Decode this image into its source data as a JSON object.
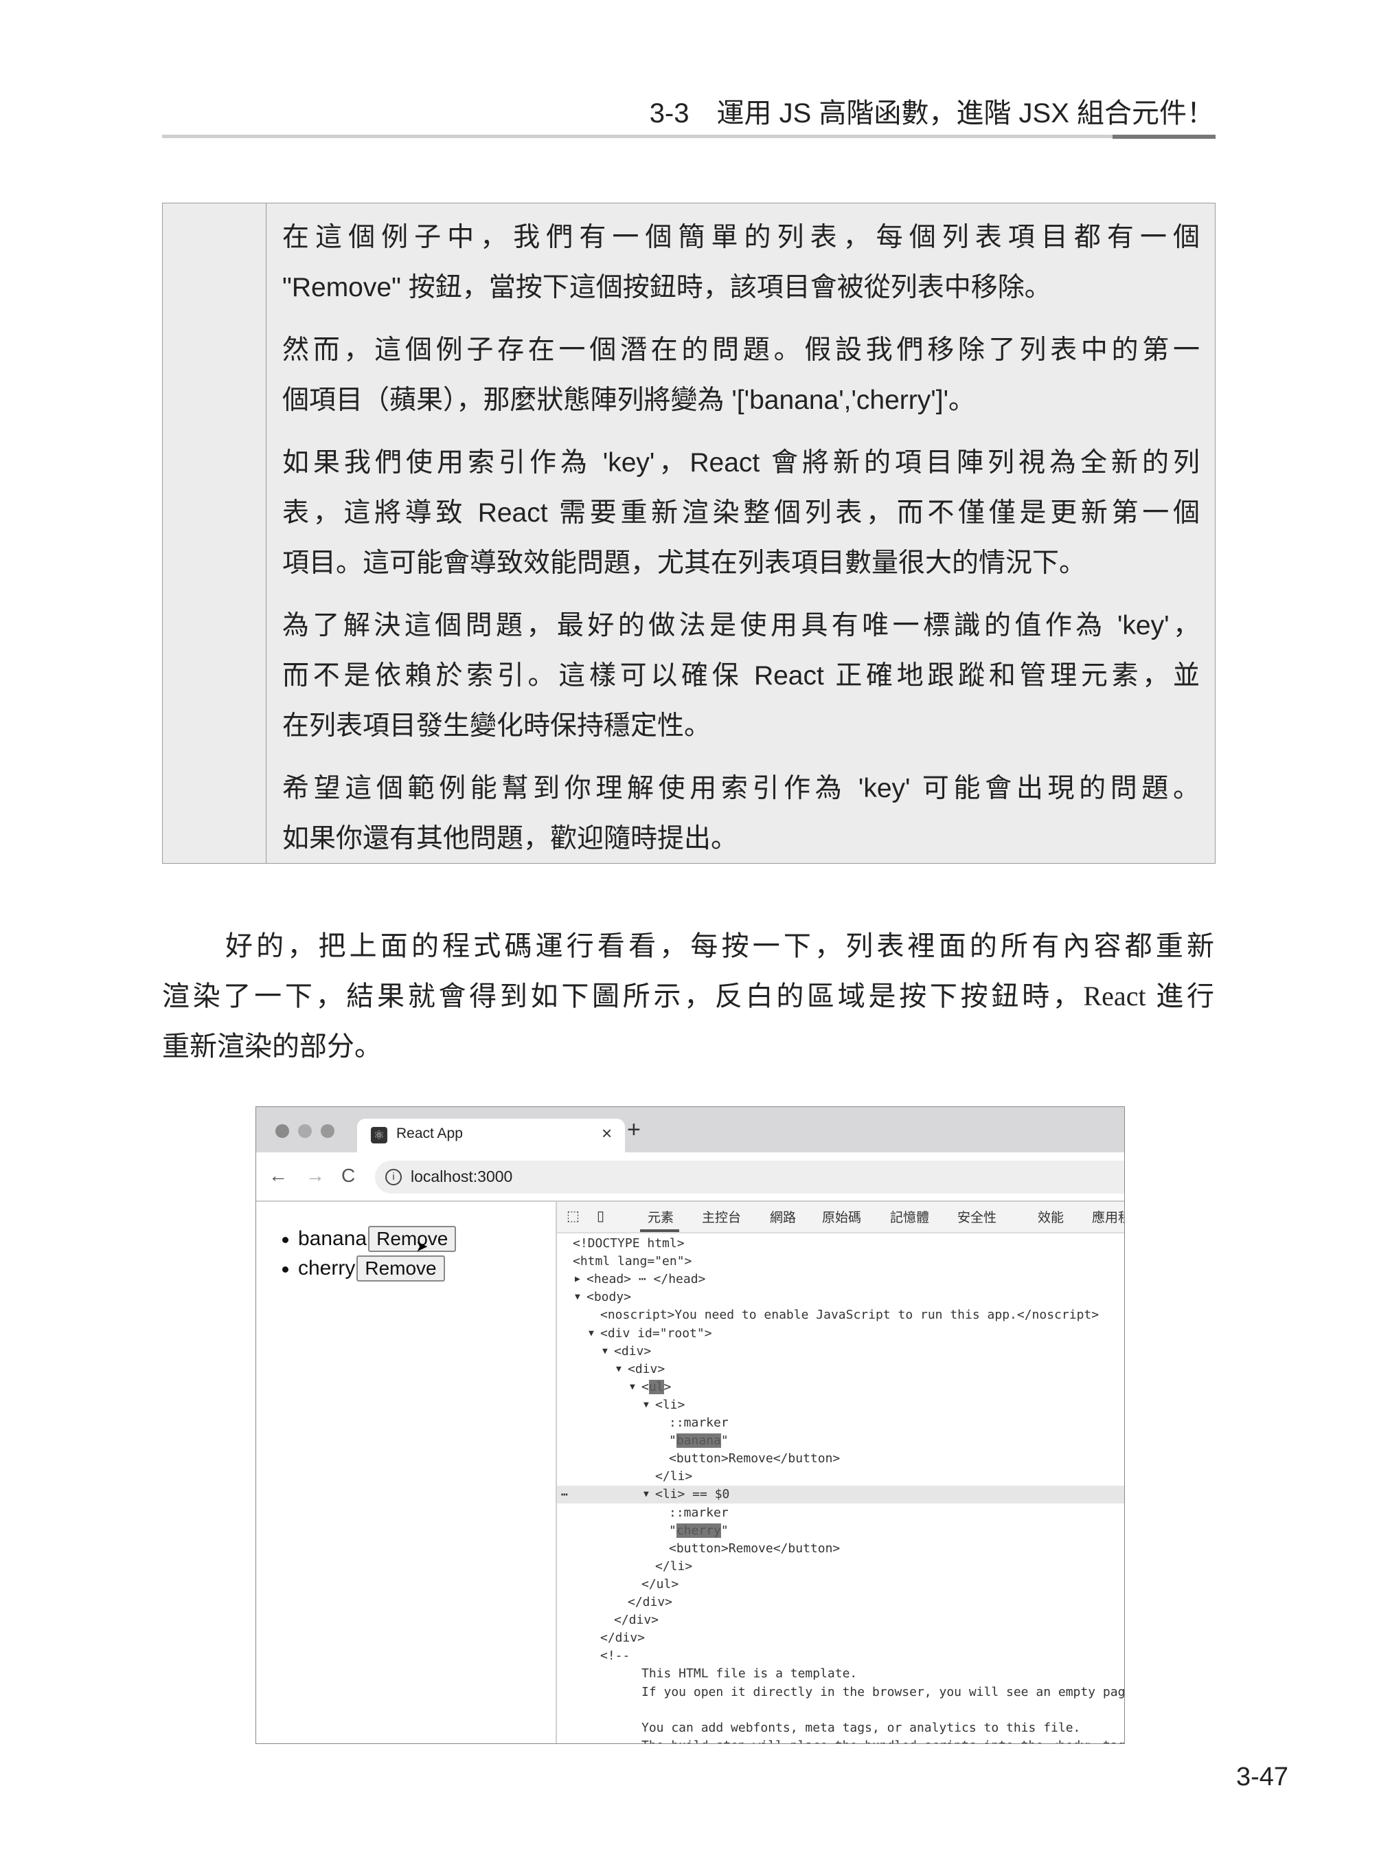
{
  "header": {
    "section_number": "3-3",
    "section_title": "運用 JS 高階函數，進階 JSX 組合元件！"
  },
  "box": {
    "paragraphs": [
      [
        "在這個例子中，我們有一個簡單的列表，每個列表項目都有一個",
        "\"Remove\" 按鈕，當按下這個按鈕時，該項目會被從列表中移除。"
      ],
      [
        "然而，這個例子存在一個潛在的問題。假設我們移除了列表中的第一",
        "個項目（蘋果），那麼狀態陣列將變為 '['banana','cherry']'。"
      ],
      [
        "如果我們使用索引作為 'key'，React 會將新的項目陣列視為全新的列",
        "表，這將導致 React 需要重新渲染整個列表，而不僅僅是更新第一個",
        "項目。這可能會導致效能問題，尤其在列表項目數量很大的情況下。"
      ],
      [
        "為了解決這個問題，最好的做法是使用具有唯一標識的值作為 'key'，",
        "而不是依賴於索引。這樣可以確保 React 正確地跟蹤和管理元素，並",
        "在列表項目發生變化時保持穩定性。"
      ],
      [
        "希望這個範例能幫到你理解使用索引作為 'key' 可能會出現的問題。",
        "如果你還有其他問題，歡迎隨時提出。"
      ]
    ]
  },
  "body": {
    "lines": [
      "好的，把上面的程式碼運行看看，每按一下，列表裡面的所有內容都重新",
      "渲染了一下，結果就會得到如下圖所示，反白的區域是按下按鈕時，React 進行",
      "重新渲染的部分。"
    ]
  },
  "screenshot": {
    "tab_title": "React App",
    "tab_close": "×",
    "new_tab": "+",
    "nav": {
      "back": "←",
      "forward": "→",
      "reload": "C"
    },
    "url": "localhost:3000",
    "items": [
      {
        "label": "banana",
        "button": "Remove"
      },
      {
        "label": "cherry",
        "button": "Remove"
      }
    ],
    "devtools": {
      "tabs": [
        "元素",
        "主控台",
        "網路",
        "原始碼",
        "記憶體",
        "安全性",
        "效能",
        "應用程式"
      ],
      "active_tab": "元素",
      "lines": [
        {
          "depth": 0,
          "pre": "<!DOCTYPE html>"
        },
        {
          "depth": 0,
          "pre": "<html lang=\"en\">"
        },
        {
          "depth": 1,
          "arrow": "closed",
          "pre": "<head> ⋯ </head>"
        },
        {
          "depth": 1,
          "arrow": "open",
          "pre": "<body>"
        },
        {
          "depth": 2,
          "pre": "<noscript>You need to enable JavaScript to run this app.</noscript>"
        },
        {
          "depth": 2,
          "arrow": "open",
          "pre": "<div id=\"root\">"
        },
        {
          "depth": 3,
          "arrow": "open",
          "pre": "<div>"
        },
        {
          "depth": 4,
          "arrow": "open",
          "pre": "<div>"
        },
        {
          "depth": 5,
          "arrow": "open",
          "pre": "<",
          "hl": "ul",
          "post": ">"
        },
        {
          "depth": 6,
          "arrow": "open",
          "pre": "<li>"
        },
        {
          "depth": 7,
          "pre": "::marker"
        },
        {
          "depth": 7,
          "pre": "\"",
          "hl": "banana",
          "post": "\""
        },
        {
          "depth": 7,
          "pre": "<button>Remove</button>"
        },
        {
          "depth": 6,
          "pre": "</li>"
        },
        {
          "depth": 6,
          "arrow": "open",
          "pre": "<li> == $0",
          "selected": true
        },
        {
          "depth": 7,
          "pre": "::marker"
        },
        {
          "depth": 7,
          "pre": "\"",
          "hl": "cherry",
          "post": "\""
        },
        {
          "depth": 7,
          "pre": "<button>Remove</button>"
        },
        {
          "depth": 6,
          "pre": "</li>"
        },
        {
          "depth": 5,
          "pre": "</ul>"
        },
        {
          "depth": 4,
          "pre": "</div>"
        },
        {
          "depth": 3,
          "pre": "</div>"
        },
        {
          "depth": 2,
          "pre": "</div>"
        },
        {
          "depth": 2,
          "pre": "<!--"
        },
        {
          "depth": 5,
          "pre": "This HTML file is a template."
        },
        {
          "depth": 5,
          "pre": "If you open it directly in the browser, you will see an empty page."
        },
        {
          "depth": 5,
          "pre": ""
        },
        {
          "depth": 5,
          "pre": "You can add webfonts, meta tags, or analytics to this file."
        },
        {
          "depth": 5,
          "pre": "The build step will place the bundled scripts into the <body> tag."
        }
      ]
    }
  },
  "page_number": "3-47"
}
